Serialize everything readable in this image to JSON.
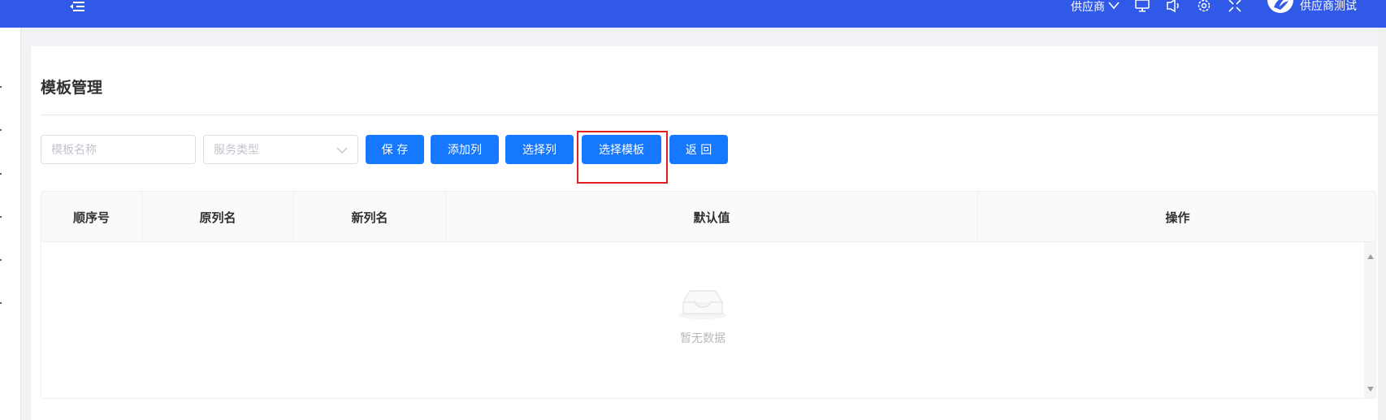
{
  "header": {
    "supplier_switch_label": "供应商",
    "username": "供应商测试",
    "icons": [
      "menu-fold-icon",
      "chevron-down-icon",
      "monitor-icon",
      "speaker-icon",
      "gear-icon",
      "fullscreen-icon",
      "avatar-logo"
    ]
  },
  "page": {
    "title": "模板管理"
  },
  "filters": {
    "template_name_placeholder": "模板名称",
    "service_type_placeholder": "服务类型"
  },
  "toolbar": {
    "save_label": "保 存",
    "add_column_label": "添加列",
    "select_column_label": "选择列",
    "select_template_label": "选择模板",
    "back_label": "返 回"
  },
  "table": {
    "columns": [
      "顺序号",
      "原列名",
      "新列名",
      "默认值",
      "操作"
    ],
    "rows": [],
    "empty_text": "暂无数据"
  },
  "colors": {
    "header_bg": "#3159e8",
    "primary": "#1677ff",
    "highlight_border": "#e02020"
  }
}
